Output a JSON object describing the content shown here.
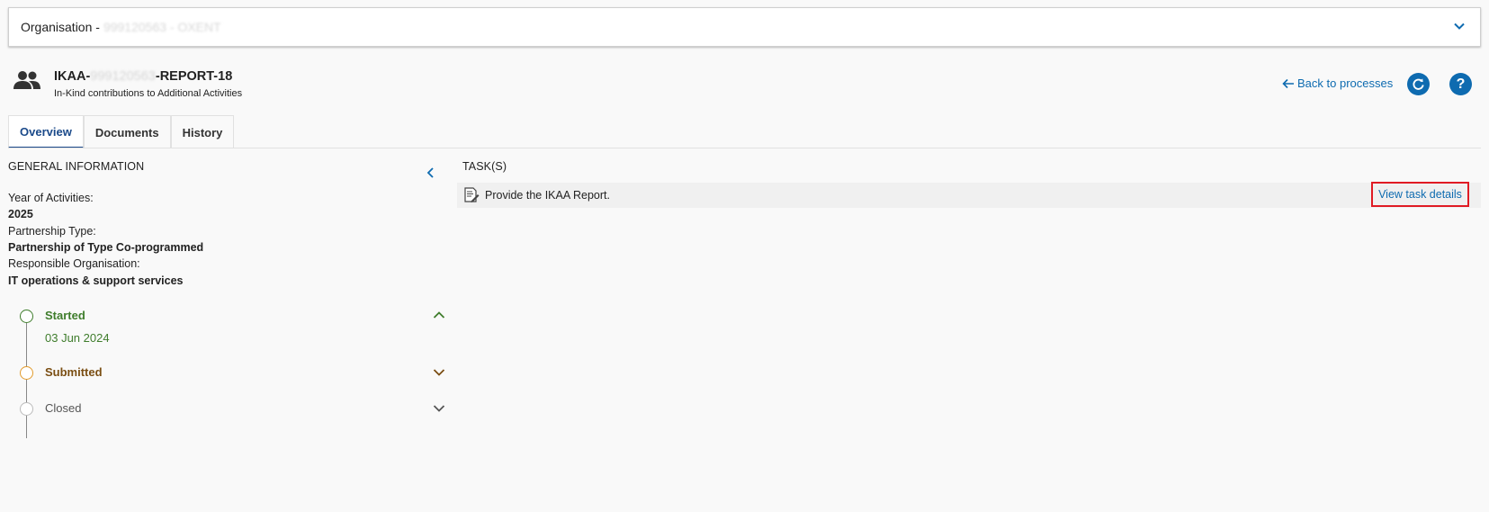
{
  "organisation": {
    "label": "Organisation - ",
    "value_redacted": "999120563 - OXENT"
  },
  "process": {
    "title_prefix": "IKAA-",
    "title_redacted": "999120563",
    "title_suffix": "-REPORT-18",
    "subtitle": "In-Kind contributions to Additional Activities",
    "back_label": "Back to processes"
  },
  "tabs": [
    {
      "label": "Overview",
      "active": true
    },
    {
      "label": "Documents",
      "active": false
    },
    {
      "label": "History",
      "active": false
    }
  ],
  "general": {
    "title": "GENERAL INFORMATION",
    "fields": [
      {
        "label": "Year of Activities:",
        "value": "2025"
      },
      {
        "label": "Partnership Type:",
        "value": "Partnership of Type Co-programmed"
      },
      {
        "label": "Responsible Organisation:",
        "value": "IT operations & support services"
      }
    ]
  },
  "timeline": {
    "started": {
      "label": "Started",
      "date": "03 Jun 2024"
    },
    "submitted": {
      "label": "Submitted"
    },
    "closed": {
      "label": "Closed"
    }
  },
  "tasks": {
    "title": "TASK(S)",
    "items": [
      {
        "text": "Provide the IKAA Report.",
        "link": "View task details"
      }
    ]
  },
  "colors": {
    "accent": "#0e6bb0",
    "started": "#3f7d2c",
    "submitted": "#e29b2c",
    "highlight": "#e01b24"
  }
}
